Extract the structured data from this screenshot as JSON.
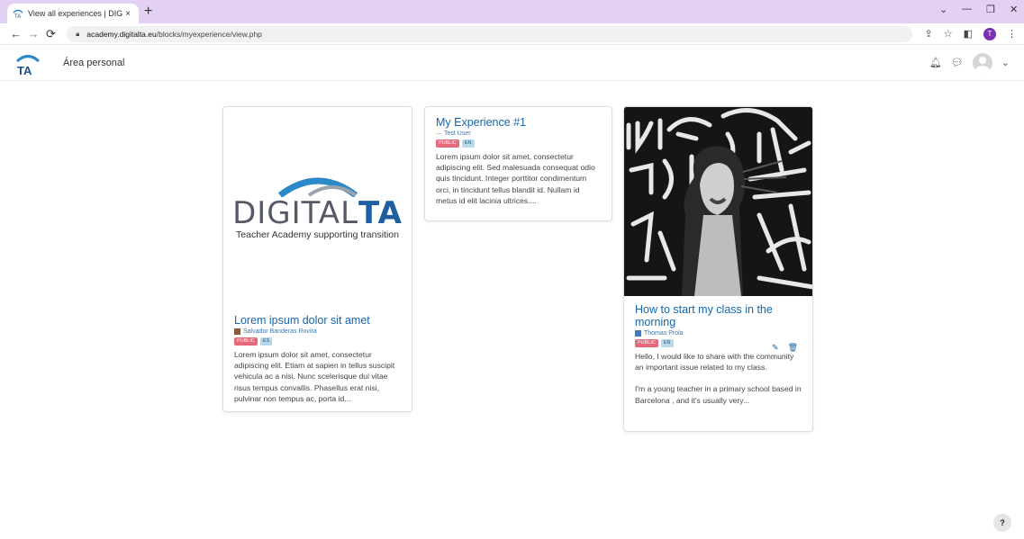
{
  "browser": {
    "tab_title": "View all experiences | DIGITALTA",
    "tab_close": "×",
    "new_tab": "+",
    "url_host": "academy.digitalta.eu",
    "url_path": "/blocks/myexperience/view.php",
    "profile_initial": "T",
    "win_min": "—",
    "win_restore": "❐",
    "win_close": "✕",
    "tab_dropdown": "⌄"
  },
  "site": {
    "nav_label": "Área personal"
  },
  "cards": [
    {
      "logo_main": "DIGITAL",
      "logo_accent": "TA",
      "logo_tagline": "Teacher Academy supporting transition",
      "title": "Lorem ipsum dolor sit amet",
      "author": "Salvador Banderas Rovira",
      "tag_public": "PUBLIC",
      "tag_lang": "ES",
      "description": "Lorem ipsum dolor sit amet, consectetur adipiscing elit. Etiam at sapien in tellus suscipit vehicula ac a nisi. Nunc scelerisque dui vitae risus tempus convallis. Phasellus erat nisi, pulvinar non tempus ac, porta id..."
    },
    {
      "title": "My Experience #1",
      "author": "Test User",
      "tag_public": "PUBLIC",
      "tag_lang": "EN",
      "description": "Lorem ipsum dolor sit amet, consectetur adipiscing elit. Sed malesuada consequat odio quis tincidunt. Integer porttitor condimentum orci, in tincidunt tellus blandit id. Nullam id metus id elit lacinia ultrices...."
    },
    {
      "title": "How to start my class in the morning",
      "author": "Thomas Prola",
      "tag_public": "PUBLIC",
      "tag_lang": "EN",
      "description_1": "Hello, I would like to share with the community an important issue related to my class.",
      "description_2": "I'm a young teacher in a primary school based in Barcelona , and it's usually very..."
    }
  ],
  "help_label": "?",
  "colors": {
    "accent": "#1765a8",
    "tab_bar": "#e3d0f2",
    "public_tag": "#e4697a",
    "lang_tag": "#b7d8e8"
  }
}
